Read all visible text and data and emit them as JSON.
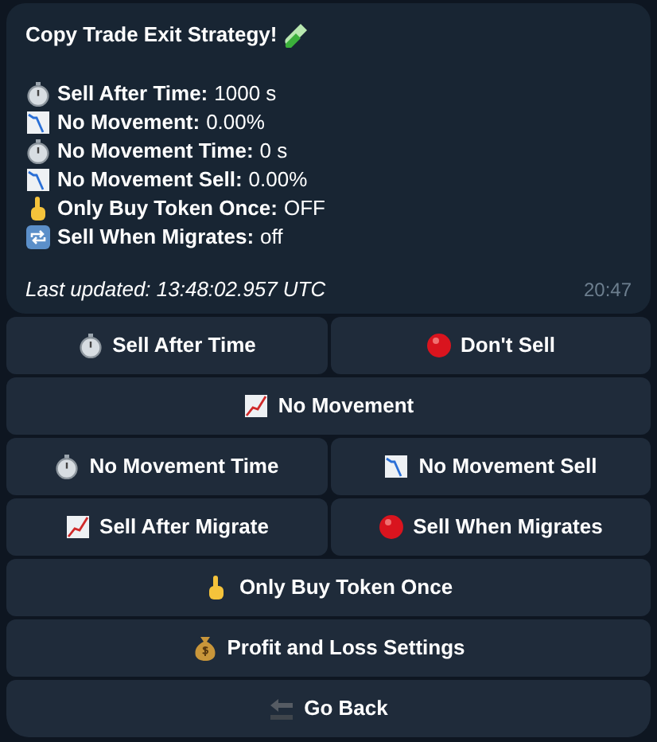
{
  "message": {
    "title": "Copy Trade Exit Strategy!",
    "lines": [
      {
        "kind": "stopwatch",
        "label": "Sell After Time:",
        "value": "1000 s"
      },
      {
        "kind": "chartdown",
        "label": "No Movement:",
        "value": "0.00%"
      },
      {
        "kind": "stopwatch",
        "label": "No Movement Time:",
        "value": "0 s"
      },
      {
        "kind": "chartdown",
        "label": "No Movement Sell:",
        "value": "0.00%"
      },
      {
        "kind": "finger",
        "label": "Only Buy Token Once:",
        "value": "OFF"
      },
      {
        "kind": "repeat",
        "label": "Sell When Migrates:",
        "value": "off"
      }
    ],
    "footer": "Last updated: 13:48:02.957 UTC",
    "time": "20:47"
  },
  "keyboard": [
    [
      {
        "kind": "stopwatch",
        "label": "Sell After Time"
      },
      {
        "kind": "circle",
        "label": "Don't Sell"
      }
    ],
    [
      {
        "kind": "chartup",
        "label": "No Movement"
      }
    ],
    [
      {
        "kind": "stopwatch",
        "label": "No Movement Time"
      },
      {
        "kind": "chartdown",
        "label": "No Movement Sell"
      }
    ],
    [
      {
        "kind": "chartup",
        "label": "Sell After Migrate"
      },
      {
        "kind": "circle",
        "label": "Sell When Migrates"
      }
    ],
    [
      {
        "kind": "finger",
        "label": "Only Buy Token Once"
      }
    ],
    [
      {
        "kind": "moneybag",
        "label": "Profit and Loss Settings"
      }
    ],
    [
      {
        "kind": "back",
        "label": "Go Back"
      }
    ]
  ]
}
